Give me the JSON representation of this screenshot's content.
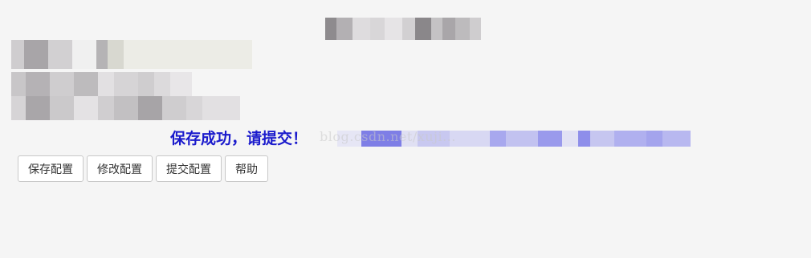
{
  "status": {
    "message": "保存成功，请提交！",
    "color": "#1a1acc",
    "watermark": "blog.csdn.net/xuji..."
  },
  "buttons": [
    {
      "label": "保存配置"
    },
    {
      "label": "修改配置"
    },
    {
      "label": "提交配置"
    },
    {
      "label": "帮助"
    }
  ]
}
